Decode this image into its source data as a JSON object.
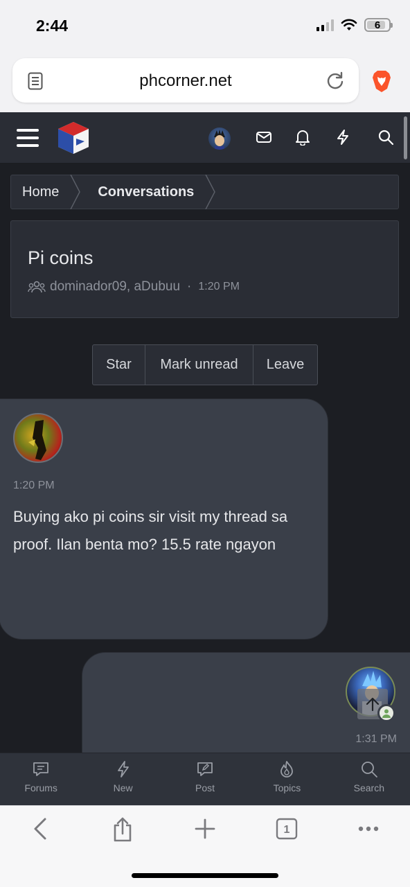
{
  "status_bar": {
    "time": "2:44",
    "battery": "6"
  },
  "browser": {
    "url": "phcorner.net"
  },
  "breadcrumb": {
    "home": "Home",
    "current": "Conversations"
  },
  "conversation": {
    "title": "Pi coins",
    "participants": "dominador09, aDubuu",
    "separator": "·",
    "time": "1:20 PM"
  },
  "actions": {
    "star": "Star",
    "mark_unread": "Mark unread",
    "leave": "Leave"
  },
  "messages": [
    {
      "time": "1:20 PM",
      "text": "Buying ako pi coins sir visit my thread sa proof. Ilan benta mo? 15.5 rate ngayon"
    },
    {
      "time": "1:31 PM"
    }
  ],
  "bottom_nav": [
    {
      "label": "Forums",
      "icon": "forums-icon"
    },
    {
      "label": "New",
      "icon": "bolt-icon"
    },
    {
      "label": "Post",
      "icon": "post-icon"
    },
    {
      "label": "Topics",
      "icon": "flame-icon"
    },
    {
      "label": "Search",
      "icon": "search-icon"
    }
  ],
  "colors": {
    "page_bg": "#1c1e23",
    "panel": "#2a2d35",
    "bubble": "#3a3f49",
    "brave": "#fb542b"
  }
}
